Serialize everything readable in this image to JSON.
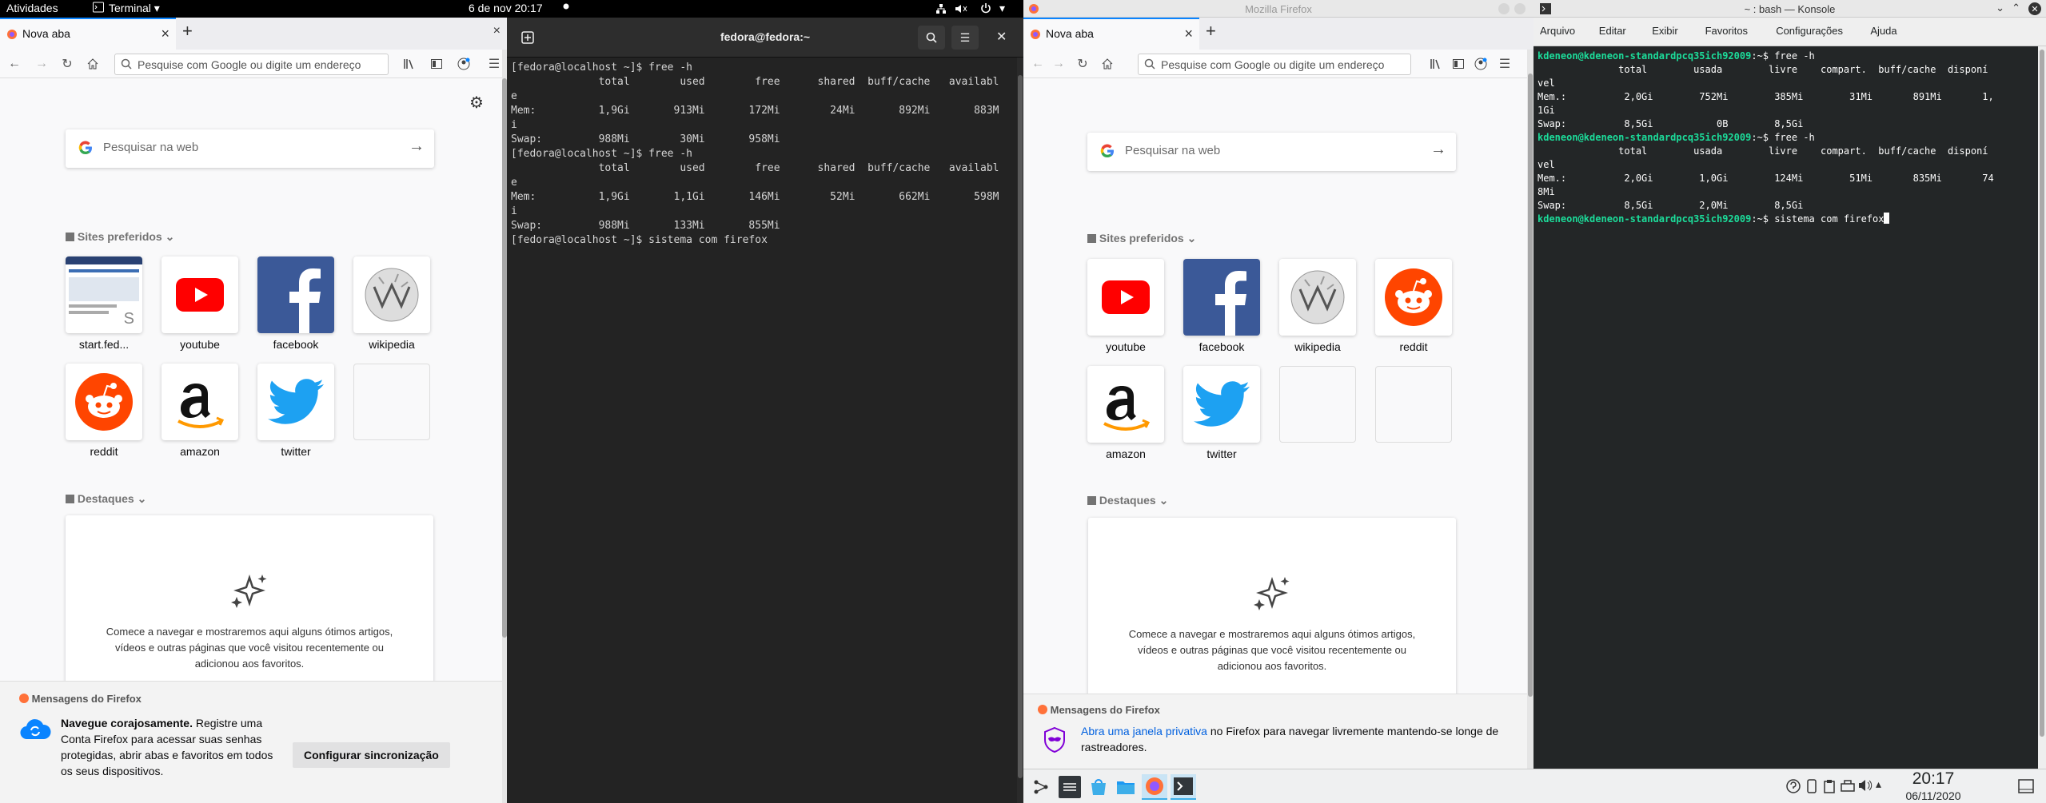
{
  "gnome_bar": {
    "activities": "Atividades",
    "app_menu": "Terminal",
    "clock": "6 de nov  20:17"
  },
  "left_firefox": {
    "tab_title": "Nova aba",
    "url_placeholder": "Pesquise com Google ou digite um endereço",
    "search_placeholder": "Pesquisar na web",
    "top_sites_header": "Sites preferidos",
    "tiles": [
      "start.fed...",
      "youtube",
      "facebook",
      "wikipedia",
      "reddit",
      "amazon",
      "twitter"
    ],
    "highlights_header": "Destaques",
    "highlights_text": "Comece a navegar e mostraremos aqui alguns ótimos artigos, vídeos e outras páginas que você visitou recentemente ou adicionou aos favoritos.",
    "messages_header": "Mensagens do Firefox",
    "message_bold": "Navegue corajosamente.",
    "message_text": " Registre uma Conta Firefox para acessar suas senhas protegidas, abrir abas e favoritos em todos os seus dispositivos.",
    "sync_button": "Configurar sincronização"
  },
  "gnome_terminal": {
    "title": "fedora@fedora:~",
    "lines": [
      "[fedora@localhost ~]$ free -h",
      "              total        used        free      shared  buff/cache   availabl",
      "e",
      "Mem:          1,9Gi       913Mi       172Mi        24Mi       892Mi       883M",
      "i",
      "Swap:         988Mi        30Mi       958Mi",
      "[fedora@localhost ~]$ free -h",
      "              total        used        free      shared  buff/cache   availabl",
      "e",
      "Mem:          1,9Gi       1,1Gi       146Mi        52Mi       662Mi       598M",
      "i",
      "Swap:         988Mi       133Mi       855Mi",
      "[fedora@localhost ~]$ sistema com firefox"
    ]
  },
  "right_firefox": {
    "window_title": "Mozilla Firefox",
    "tab_title": "Nova aba",
    "url_placeholder": "Pesquise com Google ou digite um endereço",
    "search_placeholder": "Pesquisar na web",
    "top_sites_header": "Sites preferidos",
    "tiles": [
      "youtube",
      "facebook",
      "wikipedia",
      "reddit",
      "amazon",
      "twitter"
    ],
    "highlights_header": "Destaques",
    "highlights_text": "Comece a navegar e mostraremos aqui alguns ótimos artigos, vídeos e outras páginas que você visitou recentemente ou adicionou aos favoritos.",
    "messages_header": "Mensagens do Firefox",
    "message_link": "Abra uma janela privativa",
    "message_text": " no Firefox para navegar livremente mantendo-se longe de rastreadores."
  },
  "konsole": {
    "title": "~ : bash — Konsole",
    "menu": [
      "Arquivo",
      "Editar",
      "Exibir",
      "Favoritos",
      "Configurações",
      "Ajuda"
    ],
    "prompt": "kdeneon@kdeneon-standardpcq35ich92009",
    "lines": [
      {
        "p": true,
        "t": ":~$ free -h"
      },
      {
        "p": false,
        "t": "              total        usada        livre    compart.  buff/cache  disponí"
      },
      {
        "p": false,
        "t": "vel"
      },
      {
        "p": false,
        "t": "Mem.:          2,0Gi        752Mi        385Mi        31Mi       891Mi       1,"
      },
      {
        "p": false,
        "t": "1Gi"
      },
      {
        "p": false,
        "t": "Swap:          8,5Gi           0B        8,5Gi"
      },
      {
        "p": true,
        "t": ":~$ free -h"
      },
      {
        "p": false,
        "t": "              total        usada        livre    compart.  buff/cache  disponí"
      },
      {
        "p": false,
        "t": "vel"
      },
      {
        "p": false,
        "t": "Mem.:          2,0Gi        1,0Gi        124Mi        51Mi       835Mi       74"
      },
      {
        "p": false,
        "t": "8Mi"
      },
      {
        "p": false,
        "t": "Swap:          8,5Gi        2,0Mi        8,5Gi"
      },
      {
        "p": true,
        "t": ":~$ sistema com firefox"
      }
    ]
  },
  "kde_panel": {
    "time": "20:17",
    "date": "06/11/2020"
  }
}
